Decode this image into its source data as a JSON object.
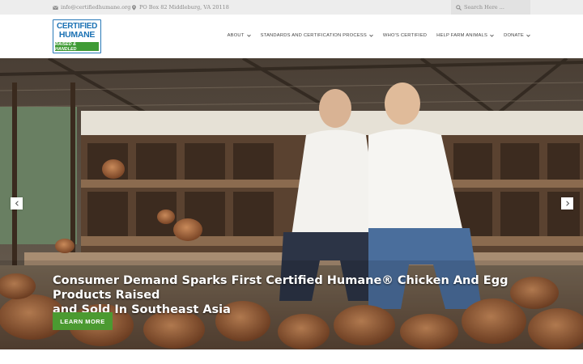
{
  "topbar": {
    "email": "info@certifiedhumane.org",
    "address": "PO Box 82 Middleburg, VA 20118",
    "search_placeholder": "Search Here ..."
  },
  "logo": {
    "line1": "CERTIFIED",
    "line2": "HUMANE",
    "tagline": "RAISED & HANDLED"
  },
  "nav": {
    "items": [
      {
        "label": "ABOUT"
      },
      {
        "label": "STANDARDS AND CERTIFICATION PROCESS"
      },
      {
        "label": "WHO'S CERTIFIED"
      },
      {
        "label": "HELP FARM ANIMALS"
      },
      {
        "label": "DONATE"
      }
    ]
  },
  "hero": {
    "title_line1": "Consumer Demand Sparks First Certified Humane® Chicken And Egg Products Raised",
    "title_line2": "and Sold In Southeast Asia",
    "cta_label": "LEARN MORE"
  },
  "colors": {
    "brand_blue": "#1c72b4",
    "brand_green": "#3f9b35",
    "button_green": "#4b9a31",
    "topbar_bg": "#ededed"
  },
  "icons": {
    "email": "envelope-icon",
    "address": "map-marker-icon",
    "search": "search-icon",
    "prev": "chevron-left-icon",
    "next": "chevron-right-icon",
    "dropdown": "chevron-down-icon"
  }
}
